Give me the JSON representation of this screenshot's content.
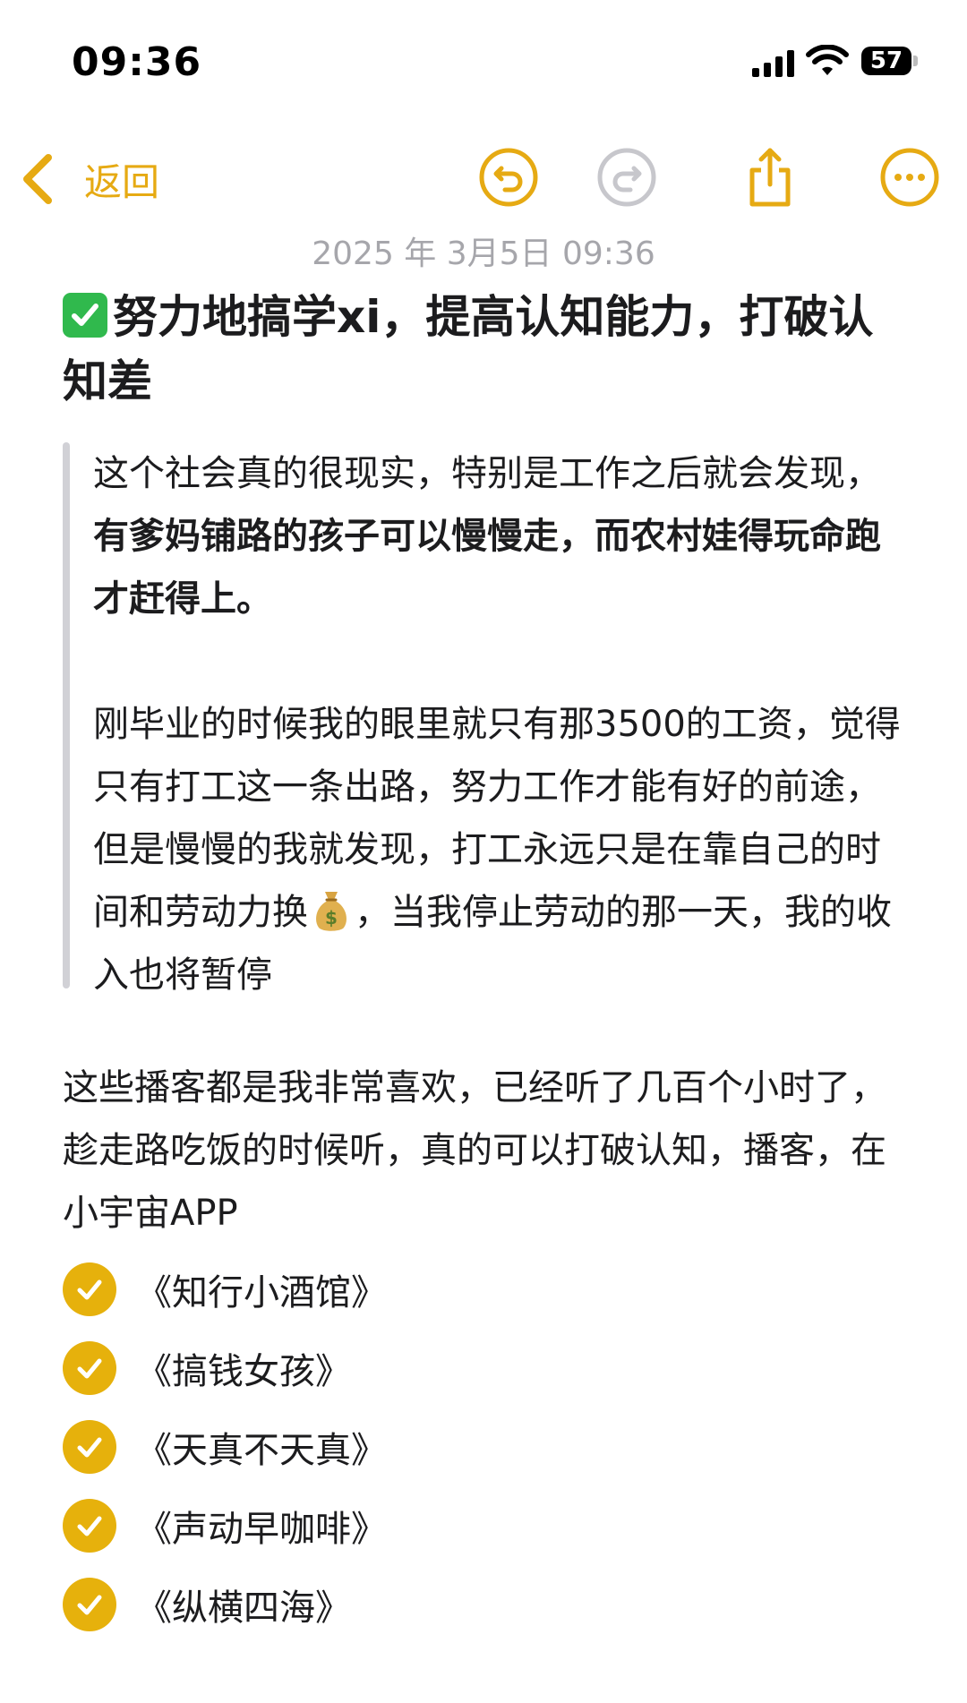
{
  "status_bar": {
    "time": "09:36",
    "battery_level": "57",
    "icons": [
      "signal-icon",
      "wifi-icon",
      "battery-icon"
    ]
  },
  "nav": {
    "back_label": "返回",
    "icons": [
      "chevron-left-icon",
      "undo-icon",
      "redo-icon",
      "share-icon",
      "more-icon"
    ],
    "accent_color": "#e6aa13"
  },
  "note": {
    "date": "2025 年 3月5日 09:36",
    "title_emoji": "✅",
    "title": "努力地搞学xi，提高认知能力，打破认知差",
    "quote": {
      "para1_lead": "这个社会真的很现实，特别是工作之后就会发现，",
      "para1_bold": "有爹妈铺路的孩子可以慢慢走，而农村娃得玩命跑才赶得上。",
      "para2_before": "刚毕业的时候我的眼里就只有那3500的工资，觉得只有打工这一条出路，努力工作才能有好的前途，但是慢慢的我就发现，打工永远只是在靠自己的时间和劳动力换",
      "para2_emoji": "💰",
      "para2_after": "，当我停止劳动的那一天，我的收入也将暂停"
    },
    "body": "这些播客都是我非常喜欢，已经听了几百个小时了，趁走路吃饭的时候听，真的可以打破认知，播客，在小宇宙APP",
    "checklist": [
      {
        "label": "《知行小酒馆》",
        "checked": true
      },
      {
        "label": "《搞钱女孩》",
        "checked": true
      },
      {
        "label": "《天真不天真》",
        "checked": true
      },
      {
        "label": "《声动早咖啡》",
        "checked": true
      },
      {
        "label": "《纵横四海》",
        "checked": true
      }
    ],
    "check_color": "#e6b10c"
  }
}
